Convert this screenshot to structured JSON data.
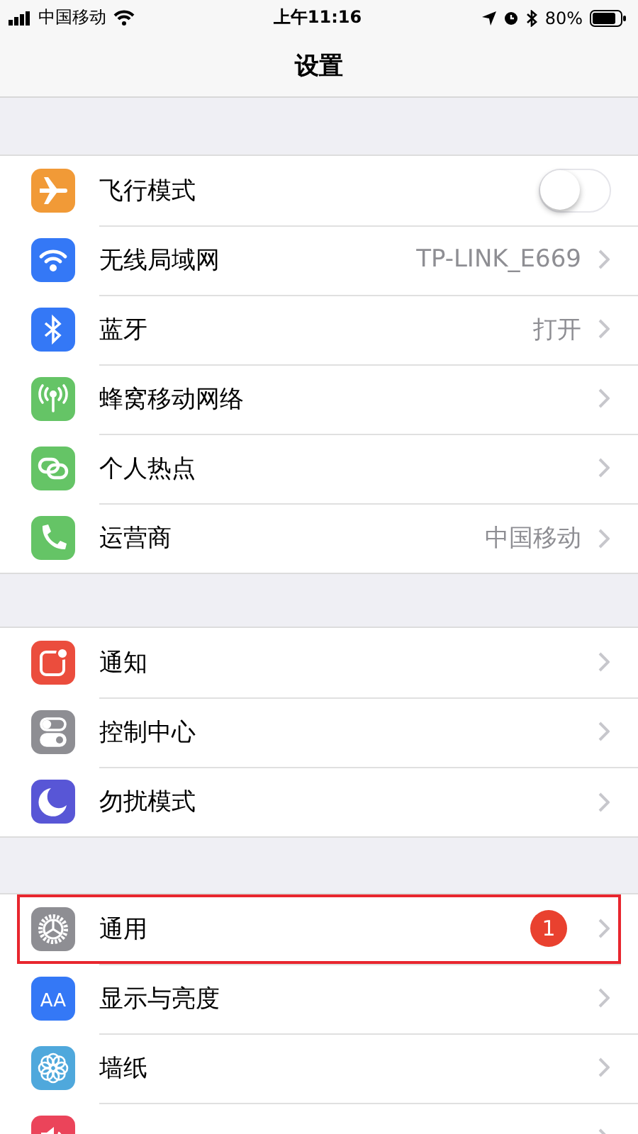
{
  "status_bar": {
    "carrier": "中国移动",
    "time": "上午11:16",
    "battery": "80%"
  },
  "nav": {
    "title": "设置"
  },
  "groups": [
    {
      "items": [
        {
          "kind": "toggle",
          "label": "飞行模式",
          "color": "#f19a37",
          "on": false
        },
        {
          "kind": "link",
          "label": "无线局域网",
          "color": "#3478f6",
          "value": "TP-LINK_E669"
        },
        {
          "kind": "link",
          "label": "蓝牙",
          "color": "#3478f6",
          "value": "打开"
        },
        {
          "kind": "link",
          "label": "蜂窝移动网络",
          "color": "#65c466"
        },
        {
          "kind": "link",
          "label": "个人热点",
          "color": "#65c466"
        },
        {
          "kind": "link",
          "label": "运营商",
          "color": "#65c466",
          "value": "中国移动"
        }
      ]
    },
    {
      "items": [
        {
          "kind": "link",
          "label": "通知",
          "color": "#eb4d3d"
        },
        {
          "kind": "link",
          "label": "控制中心",
          "color": "#8e8e93"
        },
        {
          "kind": "link",
          "label": "勿扰模式",
          "color": "#5856d6"
        }
      ]
    },
    {
      "items": [
        {
          "kind": "link",
          "label": "通用",
          "color": "#8e8e93",
          "badge": "1",
          "highlighted": true
        },
        {
          "kind": "link",
          "label": "显示与亮度",
          "color": "#3478f6",
          "icon_text": "AA",
          "highlighted": false
        },
        {
          "kind": "link",
          "label": "墙纸",
          "color": "#4fa8dc",
          "highlighted": false
        },
        {
          "kind": "link",
          "color": "#eb445a",
          "highlighted": false
        }
      ]
    }
  ]
}
